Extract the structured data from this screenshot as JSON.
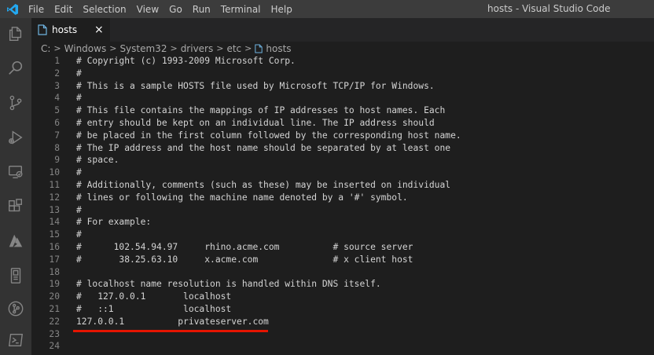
{
  "window": {
    "title": "hosts - Visual Studio Code",
    "menu": [
      "File",
      "Edit",
      "Selection",
      "View",
      "Go",
      "Run",
      "Terminal",
      "Help"
    ]
  },
  "activity_bar": {
    "icons": [
      "files-icon",
      "search-icon",
      "source-control-icon",
      "run-debug-icon",
      "remote-explorer-icon",
      "extensions-icon",
      "azure-icon",
      "device-icon",
      "git-graph-icon",
      "powershell-icon"
    ]
  },
  "tab": {
    "label": "hosts",
    "close": "×"
  },
  "breadcrumb": [
    "C:",
    "Windows",
    "System32",
    "drivers",
    "etc",
    "hosts"
  ],
  "colors": {
    "accent": "#007acc",
    "highlight": "#e51400",
    "editor_bg": "#1e1e1e"
  },
  "editor": {
    "lines": [
      {
        "n": "1",
        "text": "# Copyright (c) 1993-2009 Microsoft Corp."
      },
      {
        "n": "2",
        "text": "#"
      },
      {
        "n": "3",
        "text": "# This is a sample HOSTS file used by Microsoft TCP/IP for Windows."
      },
      {
        "n": "4",
        "text": "#"
      },
      {
        "n": "5",
        "text": "# This file contains the mappings of IP addresses to host names. Each"
      },
      {
        "n": "6",
        "text": "# entry should be kept on an individual line. The IP address should"
      },
      {
        "n": "7",
        "text": "# be placed in the first column followed by the corresponding host name."
      },
      {
        "n": "8",
        "text": "# The IP address and the host name should be separated by at least one"
      },
      {
        "n": "9",
        "text": "# space."
      },
      {
        "n": "10",
        "text": "#"
      },
      {
        "n": "11",
        "text": "# Additionally, comments (such as these) may be inserted on individual"
      },
      {
        "n": "12",
        "text": "# lines or following the machine name denoted by a '#' symbol."
      },
      {
        "n": "13",
        "text": "#"
      },
      {
        "n": "14",
        "text": "# For example:"
      },
      {
        "n": "15",
        "text": "#"
      },
      {
        "n": "16",
        "text": "#      102.54.94.97     rhino.acme.com          # source server"
      },
      {
        "n": "17",
        "text": "#       38.25.63.10     x.acme.com              # x client host"
      },
      {
        "n": "18",
        "text": ""
      },
      {
        "n": "19",
        "text": "# localhost name resolution is handled within DNS itself."
      },
      {
        "n": "20",
        "text": "#   127.0.0.1       localhost"
      },
      {
        "n": "21",
        "text": "#   ::1             localhost"
      },
      {
        "n": "22",
        "text": "127.0.0.1          privateserver.com"
      },
      {
        "n": "23",
        "text": ""
      },
      {
        "n": "24",
        "text": ""
      }
    ]
  }
}
